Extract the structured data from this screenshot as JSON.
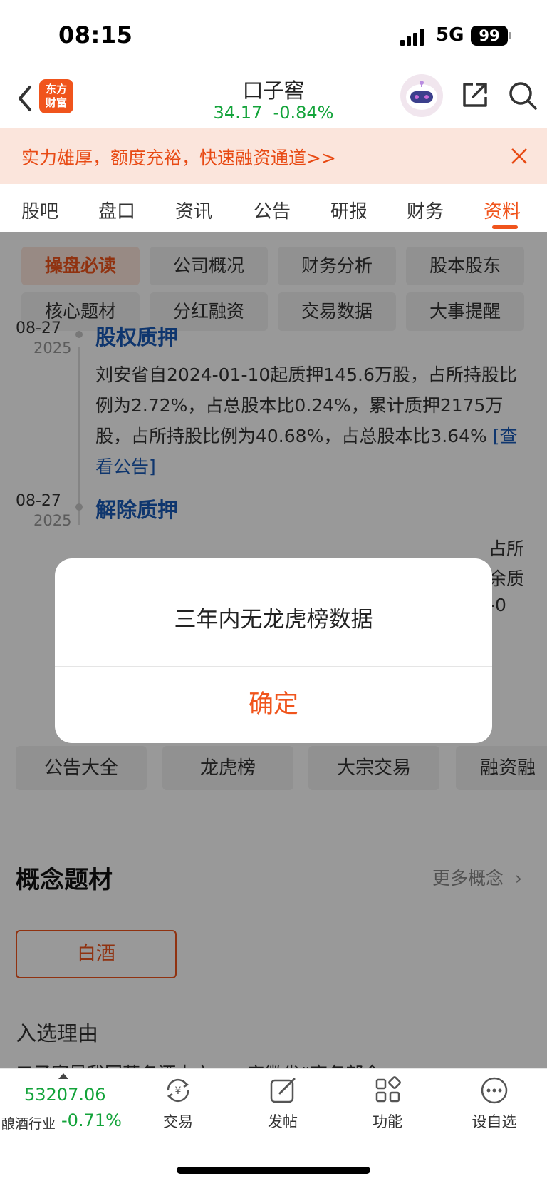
{
  "status_bar": {
    "time": "08:15",
    "network": "5G",
    "battery": "99"
  },
  "header": {
    "logo_line1": "东方",
    "logo_line2": "财富",
    "stock_name": "口子窖",
    "price": "34.17",
    "change": "-0.84%"
  },
  "banner": {
    "text": "实力雄厚，额度充裕，快速融资通道>>"
  },
  "tabs": [
    "股吧",
    "盘口",
    "资讯",
    "公告",
    "研报",
    "财务",
    "资料"
  ],
  "active_tab": "资料",
  "chips": [
    "操盘必读",
    "公司概况",
    "财务分析",
    "股本股东",
    "核心题材",
    "分红融资",
    "交易数据",
    "大事提醒"
  ],
  "timeline": [
    {
      "date": "08-27",
      "year": "2025",
      "title": "股权质押",
      "body": "刘安省自2024-01-10起质押145.6万股，占所持股比例为2.72%，占总股本比0.24%，累计质押2175万股，占所持股比例为40.68%，占总股本比3.64%",
      "link": "[查看公告]"
    },
    {
      "date": "08-27",
      "year": "2025",
      "title": "解除质押",
      "partial_lines": [
        "占所",
        "余质",
        "-0"
      ]
    }
  ],
  "quick_links": [
    "公告大全",
    "龙虎榜",
    "大宗交易",
    "融资融"
  ],
  "concept": {
    "title": "概念题材",
    "more": "更多概念",
    "tag": "白酒",
    "reason_label": "入选理由",
    "reason_text": "口子窖是我国著名酒中之一…安徽省“商务部命"
  },
  "bottom_bar": {
    "index_value": "53207.06",
    "index_name": "酿酒行业",
    "index_change": "-0.71%",
    "nav": [
      {
        "label": "交易",
        "icon": "yuan-exchange-icon"
      },
      {
        "label": "发帖",
        "icon": "edit-icon"
      },
      {
        "label": "功能",
        "icon": "grid-icon"
      },
      {
        "label": "设自选",
        "icon": "more-dots-icon"
      }
    ]
  },
  "dialog": {
    "message": "三年内无龙虎榜数据",
    "confirm": "确定"
  },
  "colors": {
    "accent": "#f0541c",
    "down_green": "#13a33a",
    "link_blue": "#1a5bb8"
  }
}
